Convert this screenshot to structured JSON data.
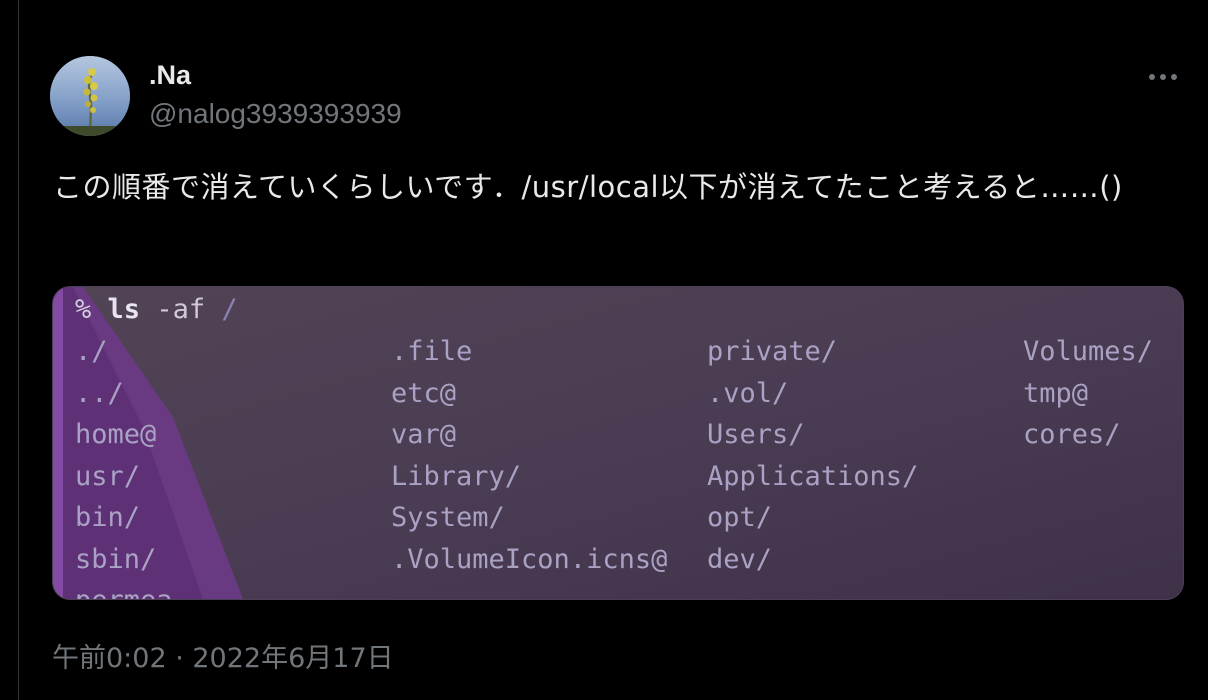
{
  "user": {
    "display_name": ".Na",
    "handle": "@nalog3939393939"
  },
  "tweet": {
    "text": "この順番で消えていくらしいです．/usr/local以下が消えてたこと考えると……()",
    "timestamp": "午前0:02 · 2022年6月17日"
  },
  "terminal": {
    "prompt_percent": "%",
    "prompt_cmd": "ls",
    "prompt_args": "-af",
    "prompt_path": "/",
    "columns": [
      [
        "./",
        "../",
        "home@",
        "usr/",
        "bin/",
        "sbin/",
        "permea..."
      ],
      [
        ".file",
        "etc@",
        "var@",
        "Library/",
        "System/",
        ".VolumeIcon.icns@"
      ],
      [
        "private/",
        ".vol/",
        "Users/",
        "Applications/",
        "opt/",
        "dev/"
      ],
      [
        "Volumes/",
        "tmp@",
        "cores/"
      ]
    ]
  },
  "icons": {
    "more": "more-horizontal-icon"
  },
  "colors": {
    "background": "#000000",
    "primary_text": "#e7e9ea",
    "secondary_text": "#71767b",
    "terminal_bg": "#4a3b50",
    "terminal_accent": "#6a3a84"
  }
}
